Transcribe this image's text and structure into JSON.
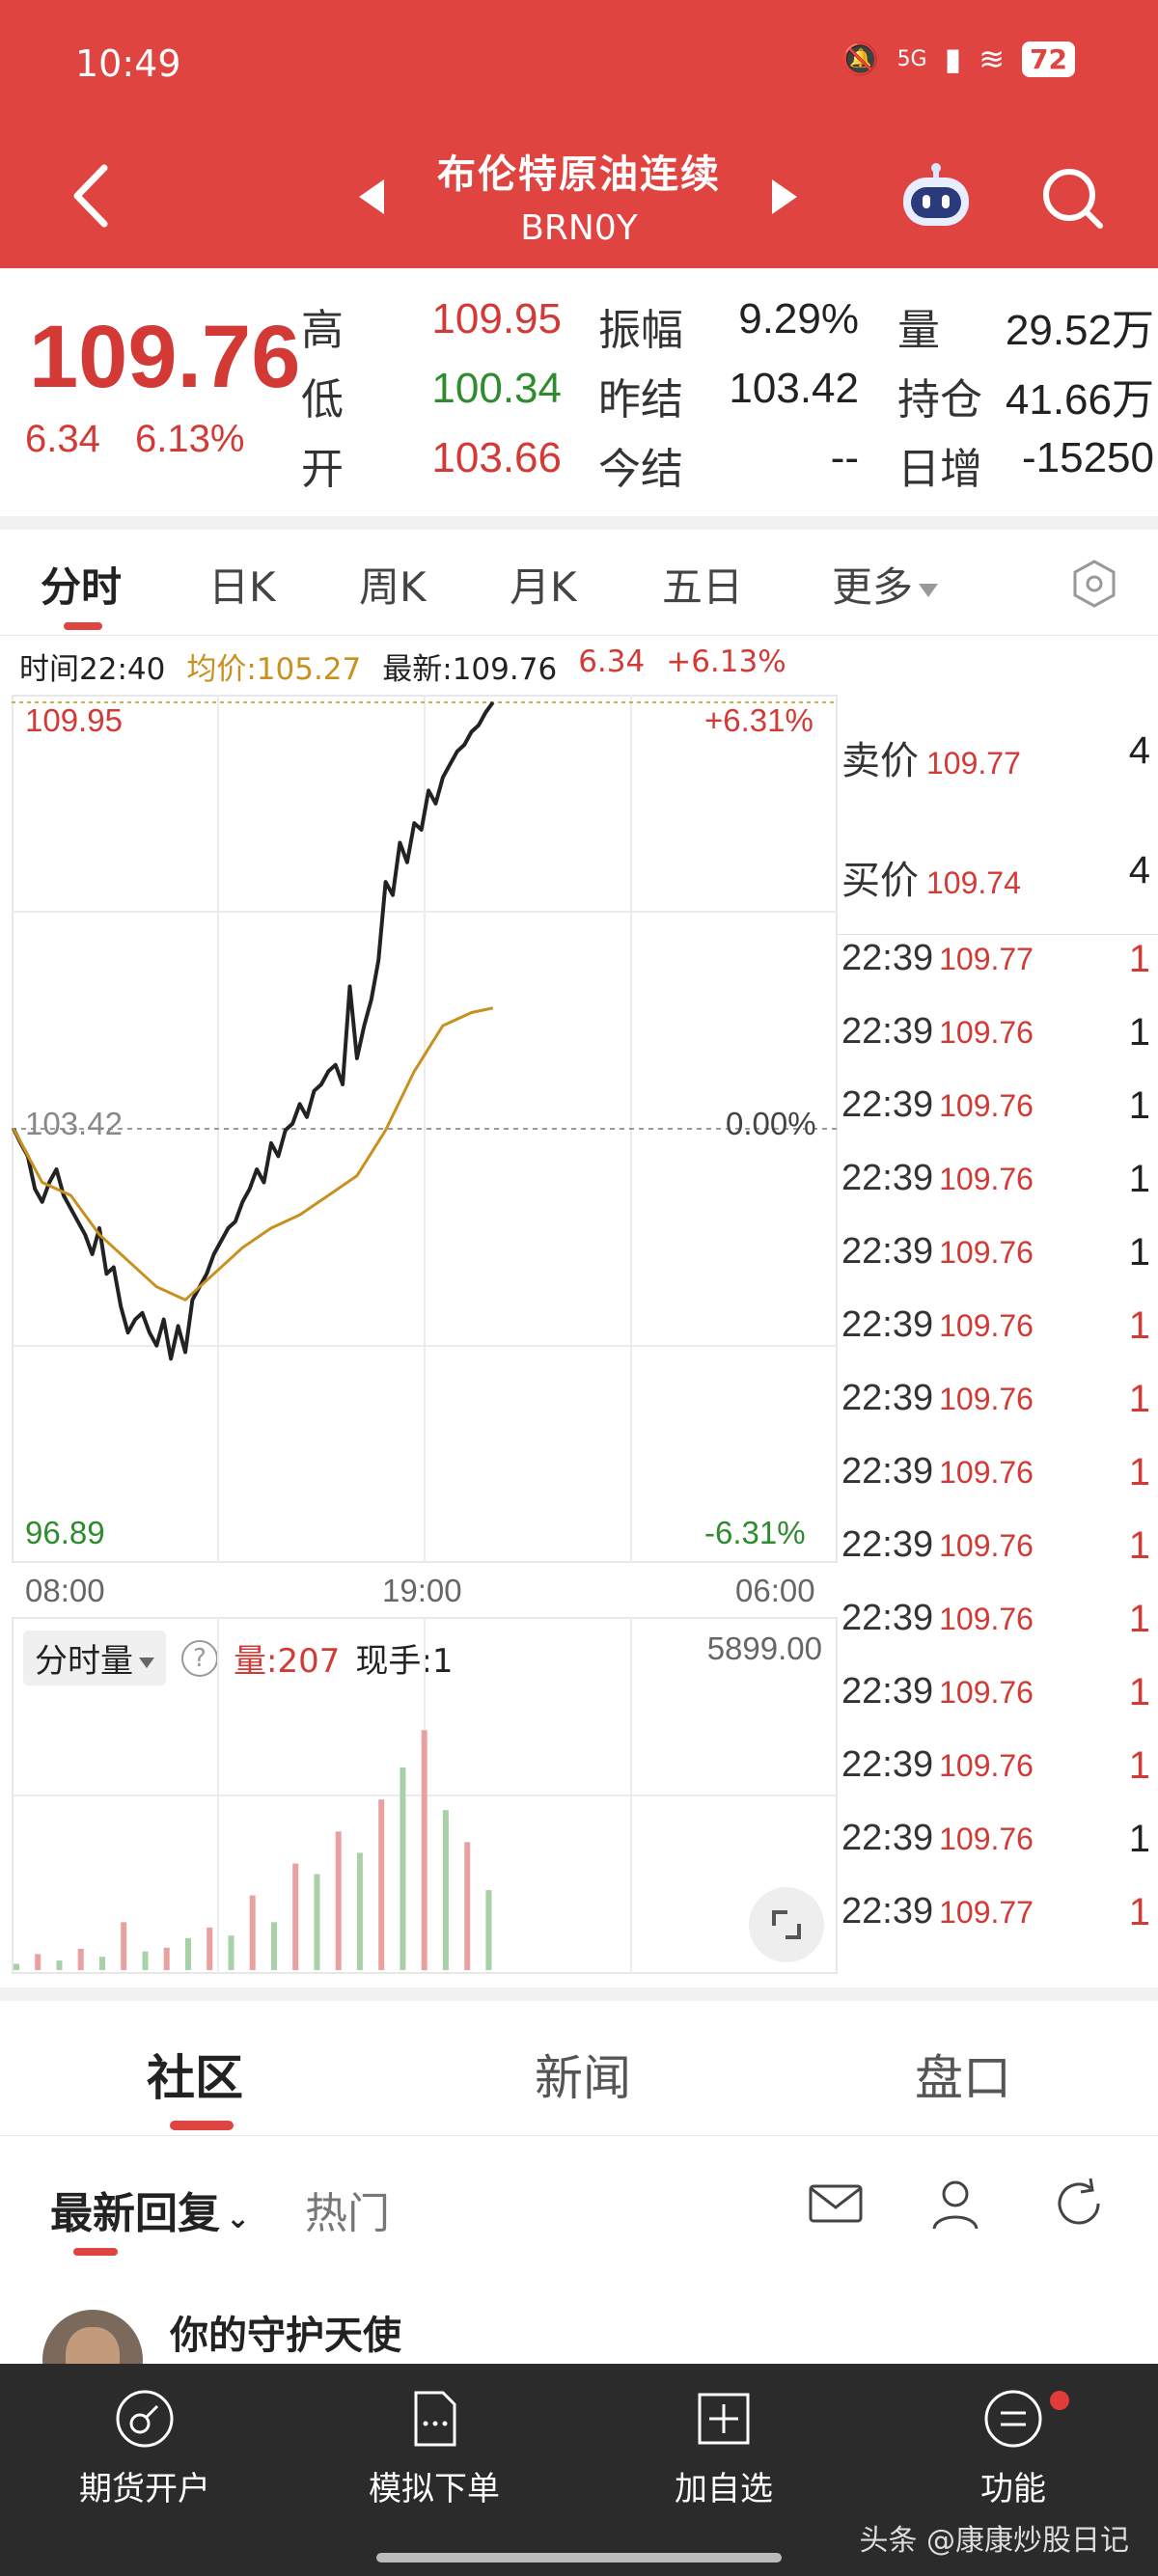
{
  "status": {
    "time": "10:49",
    "network": "5G",
    "battery": "72"
  },
  "header": {
    "name": "布伦特原油连续",
    "code": "BRN0Y"
  },
  "quote": {
    "price": "109.76",
    "change": "6.34",
    "change_pct": "6.13%",
    "rows": [
      {
        "l1": "高",
        "v1": "109.95",
        "l2": "振幅",
        "v2": "9.29%",
        "l3": "量",
        "v3": "29.52万"
      },
      {
        "l1": "低",
        "v1": "100.34",
        "l2": "昨结",
        "v2": "103.42",
        "l3": "持仓",
        "v3": "41.66万"
      },
      {
        "l1": "开",
        "v1": "103.66",
        "l2": "今结",
        "v2": "--",
        "l3": "日增",
        "v3": "-15250"
      }
    ],
    "colors": {
      "up": "#d33a36",
      "down": "#2e8b2e",
      "flat": "#222222"
    }
  },
  "tabs": [
    "分时",
    "日K",
    "周K",
    "月K",
    "五日",
    "更多"
  ],
  "info": {
    "time": "时间22:40",
    "avg": "均价:105.27",
    "latest": "最新:109.76",
    "chg": "6.34",
    "pct": "+6.13%"
  },
  "axis": {
    "top_price": "109.95",
    "mid_price": "103.42",
    "bottom_price": "96.89",
    "top_pct": "+6.31%",
    "mid_pct": "0.00%",
    "bottom_pct": "-6.31%",
    "times": [
      "08:00",
      "19:00",
      "06:00"
    ]
  },
  "volume": {
    "selector": "分时量",
    "help": "?",
    "vol": "量:207",
    "hand": "现手:1",
    "max": "5899.00"
  },
  "book": {
    "sell_label": "卖价",
    "sell_price": "109.77",
    "sell_qty": "4",
    "buy_label": "买价",
    "buy_price": "109.74",
    "buy_qty": "4",
    "ticks": [
      {
        "time": "22:39",
        "price": "109.77",
        "qty": "1",
        "up": true
      },
      {
        "time": "22:39",
        "price": "109.76",
        "qty": "1",
        "up": false
      },
      {
        "time": "22:39",
        "price": "109.76",
        "qty": "1",
        "up": false
      },
      {
        "time": "22:39",
        "price": "109.76",
        "qty": "1",
        "up": false
      },
      {
        "time": "22:39",
        "price": "109.76",
        "qty": "1",
        "up": false
      },
      {
        "time": "22:39",
        "price": "109.76",
        "qty": "1",
        "up": true
      },
      {
        "time": "22:39",
        "price": "109.76",
        "qty": "1",
        "up": true
      },
      {
        "time": "22:39",
        "price": "109.76",
        "qty": "1",
        "up": true
      },
      {
        "time": "22:39",
        "price": "109.76",
        "qty": "1",
        "up": true
      },
      {
        "time": "22:39",
        "price": "109.76",
        "qty": "1",
        "up": true
      },
      {
        "time": "22:39",
        "price": "109.76",
        "qty": "1",
        "up": true
      },
      {
        "time": "22:39",
        "price": "109.76",
        "qty": "1",
        "up": true
      },
      {
        "time": "22:39",
        "price": "109.76",
        "qty": "1",
        "up": false
      },
      {
        "time": "22:39",
        "price": "109.77",
        "qty": "1",
        "up": true
      }
    ]
  },
  "community": {
    "tabs": [
      "社区",
      "新闻",
      "盘口"
    ],
    "reply_tabs": [
      "最新回复",
      "热门"
    ],
    "post_user": "你的守护天使"
  },
  "bottom_nav": [
    "期货开户",
    "模拟下单",
    "加自选",
    "功能"
  ],
  "credit": "头条 @康康炒股日记",
  "chart_data": {
    "type": "line",
    "title": "",
    "ylim": [
      96.89,
      109.95
    ],
    "prev_settle": 103.42,
    "x_ticks": [
      "08:00",
      "19:00",
      "06:00"
    ],
    "series": [
      {
        "name": "",
        "color": "#222222",
        "x": [
          0,
          2,
          4,
          6,
          8,
          10,
          12,
          14,
          16,
          18,
          20,
          22,
          24,
          26,
          28,
          30,
          32,
          34,
          36,
          38,
          40,
          42,
          44,
          46,
          48,
          50,
          52,
          54,
          56,
          58,
          60,
          62,
          64,
          66,
          68,
          70,
          72,
          74,
          76,
          78,
          80,
          82,
          84,
          86,
          88,
          90,
          92,
          94,
          96,
          98,
          100,
          102,
          104,
          106,
          108,
          110,
          112,
          114,
          116,
          118,
          120,
          122,
          124,
          126,
          128,
          130,
          132,
          134
        ],
        "values": [
          103.42,
          103.2,
          103.0,
          102.5,
          102.3,
          102.6,
          102.8,
          102.4,
          102.2,
          102.0,
          101.8,
          101.5,
          101.9,
          101.2,
          101.3,
          100.7,
          100.3,
          100.5,
          100.6,
          100.3,
          100.1,
          100.5,
          99.9,
          100.4,
          100.0,
          100.8,
          101.0,
          101.2,
          101.5,
          101.7,
          101.9,
          102.0,
          102.3,
          102.5,
          102.8,
          102.6,
          103.2,
          103.0,
          103.4,
          103.5,
          103.8,
          103.6,
          104.0,
          104.1,
          104.3,
          104.4,
          104.1,
          105.6,
          104.5,
          105.0,
          105.4,
          106.0,
          107.2,
          107.0,
          107.8,
          107.5,
          108.1,
          108.0,
          108.6,
          108.4,
          108.8,
          109.0,
          109.2,
          109.3,
          109.5,
          109.6,
          109.8,
          109.95
        ]
      },
      {
        "name": "",
        "color": "#c8901e",
        "x": [
          0,
          8,
          16,
          24,
          32,
          40,
          48,
          56,
          64,
          72,
          80,
          88,
          96,
          104,
          112,
          120,
          128,
          134
        ],
        "values": [
          103.42,
          102.6,
          102.4,
          101.8,
          101.4,
          101.0,
          100.8,
          101.2,
          101.6,
          101.9,
          102.1,
          102.4,
          102.7,
          103.4,
          104.3,
          105.0,
          105.2,
          105.27
        ]
      }
    ],
    "volume": {
      "ylim": [
        0,
        5899
      ],
      "x": [
        0,
        6,
        12,
        18,
        24,
        30,
        36,
        42,
        48,
        54,
        60,
        66,
        72,
        78,
        84,
        90,
        96,
        102,
        108,
        114,
        120,
        126,
        132
      ],
      "values": [
        120,
        300,
        180,
        400,
        250,
        900,
        350,
        420,
        600,
        800,
        650,
        1400,
        900,
        2000,
        1800,
        2600,
        2200,
        3200,
        3800,
        4500,
        3000,
        2400,
        1500
      ]
    }
  }
}
